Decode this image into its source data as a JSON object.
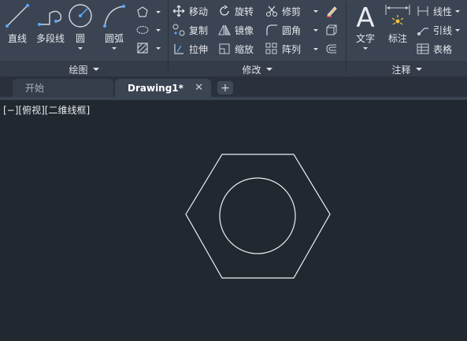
{
  "ribbon": {
    "draw": {
      "title": "绘图",
      "line": "直线",
      "polyline": "多段线",
      "circle": "圆",
      "arc": "圆弧"
    },
    "modify": {
      "title": "修改",
      "move": "移动",
      "rotate": "旋转",
      "trim": "修剪",
      "copy": "复制",
      "mirror": "镜像",
      "fillet": "圆角",
      "stretch": "拉伸",
      "scale": "缩放",
      "array": "阵列"
    },
    "annotation": {
      "title": "注释",
      "text": "文字",
      "dimension": "标注",
      "linear": "线性",
      "leader": "引线",
      "table": "表格"
    }
  },
  "tabs": {
    "start": "开始",
    "drawing": "Drawing1*",
    "close": "✕",
    "add": "+"
  },
  "canvas": {
    "viewport_label": "[−][俯视][二维线框]"
  }
}
